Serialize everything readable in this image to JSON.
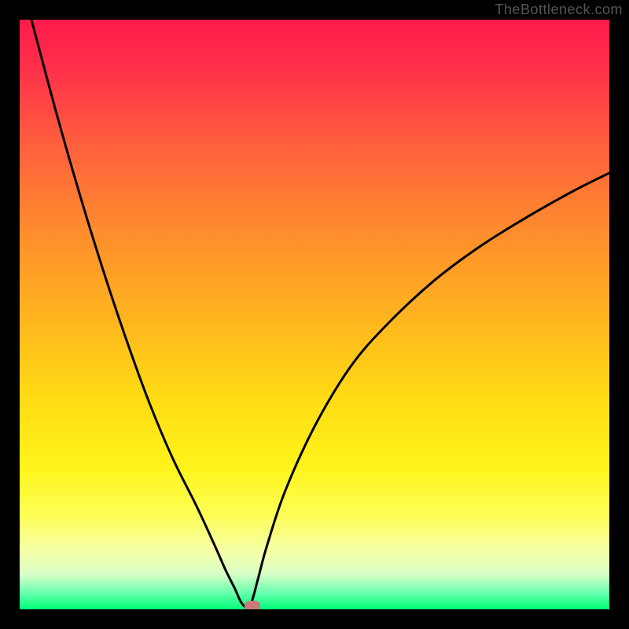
{
  "watermark": "TheBottleneck.com",
  "chart_data": {
    "type": "line",
    "title": "",
    "xlabel": "",
    "ylabel": "",
    "xlim": [
      0,
      100
    ],
    "ylim": [
      0,
      100
    ],
    "grid": false,
    "series": [
      {
        "name": "bottleneck-curve",
        "x": [
          2,
          6,
          10,
          14,
          18,
          22,
          26,
          30,
          33,
          35,
          36.5,
          37.5,
          38.5,
          39.2,
          39.8,
          40.5,
          42,
          45,
          50,
          56,
          62,
          70,
          78,
          86,
          94,
          100
        ],
        "y": [
          100,
          85,
          71,
          58,
          46,
          35,
          25.5,
          17.5,
          11,
          6.5,
          3.5,
          1.3,
          0.3,
          0.9,
          2.8,
          5.5,
          11,
          20,
          31,
          41,
          48,
          55.5,
          61.5,
          66.5,
          71,
          74
        ]
      }
    ],
    "marker": {
      "x": 39.5,
      "y": 0.5,
      "color": "#c97b7b"
    },
    "background_gradient": {
      "direction": "top-to-bottom",
      "stops": [
        {
          "pos": 0,
          "color": "#ff1a4b"
        },
        {
          "pos": 50,
          "color": "#ffb31f"
        },
        {
          "pos": 80,
          "color": "#fff41a"
        },
        {
          "pos": 100,
          "color": "#00ff78"
        }
      ]
    }
  }
}
